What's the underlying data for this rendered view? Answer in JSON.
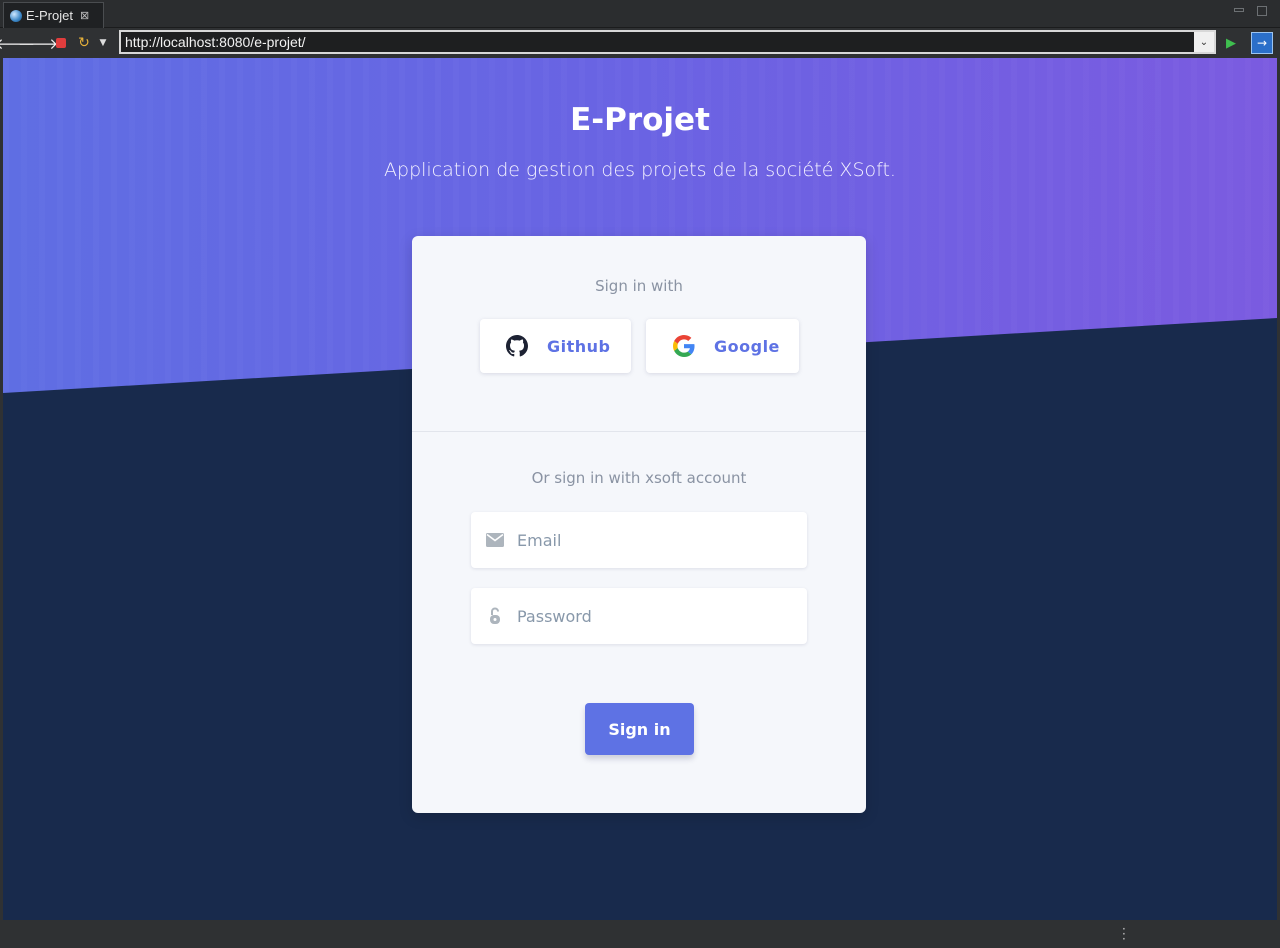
{
  "browser": {
    "tab_title": "E-Projet",
    "tab_close": "⊠",
    "url": "http://localhost:8080/e-projet/",
    "icons": [
      "globe-icon",
      "back-arrow-icon",
      "forward-arrow-icon",
      "stop-icon",
      "refresh-icon",
      "dropdown-icon",
      "go-icon",
      "external-browser-icon"
    ]
  },
  "hero": {
    "title": "E-Projet",
    "subtitle": "Application de gestion des projets de la société XSoft."
  },
  "login": {
    "signin_with": "Sign in with",
    "github_label": "Github",
    "google_label": "Google",
    "or_signin": "Or sign in with xsoft account",
    "email_placeholder": "Email",
    "password_placeholder": "Password",
    "submit_label": "Sign in"
  },
  "colors": {
    "primary": "#5e72e4",
    "hero_gradient_start": "#5f6ee3",
    "hero_gradient_end": "#7b5be0",
    "background_dark": "#182a4c",
    "card_bg": "#f5f7fb"
  }
}
